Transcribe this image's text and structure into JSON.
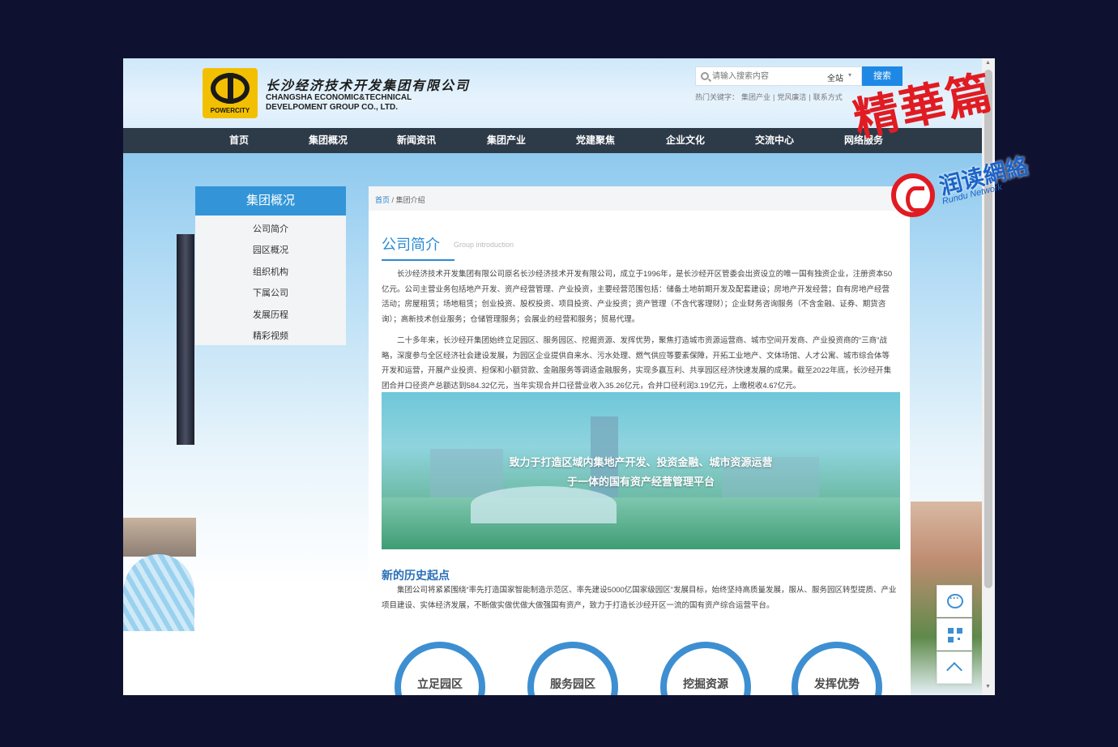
{
  "header": {
    "logo_cn": "长沙经济技术开发集团有限公司",
    "logo_en_line1": "CHANGSHA ECONOMIC&TECHNICAL",
    "logo_en_line2": "DEVELPOMENT GROUP CO., LTD.",
    "emblem_label": "POWERCITY",
    "search": {
      "placeholder": "请输入搜索内容",
      "scope": "全站",
      "button": "搜索"
    },
    "hotwords": {
      "label": "热门关键字：",
      "items": [
        "集团产业",
        "党风廉洁",
        "联系方式"
      ]
    }
  },
  "nav": [
    "首页",
    "集团概况",
    "新闻资讯",
    "集团产业",
    "党建聚焦",
    "企业文化",
    "交流中心",
    "网络服务"
  ],
  "sidebar": {
    "title": "集团概况",
    "items": [
      "公司简介",
      "园区概况",
      "组织机构",
      "下属公司",
      "发展历程",
      "精彩视频"
    ]
  },
  "breadcrumb": {
    "home": "首页",
    "sep": "/",
    "current": "集团介绍"
  },
  "section": {
    "title": "公司简介",
    "subtitle": "Group introduction",
    "para1": "长沙经济技术开发集团有限公司原名长沙经济技术开发有限公司，成立于1996年，是长沙经开区管委会出资设立的唯一国有独资企业，注册资本50亿元。公司主营业务包括地产开发、资产经营管理、产业投资，主要经营范围包括：储备土地前期开发及配套建设；房地产开发经营；自有房地产经营活动；房屋租赁；场地租赁；创业投资、股权投资、项目投资、产业投资；资产管理（不含代客理财）；企业财务咨询服务（不含金融、证券、期货咨询）；高新技术创业服务；仓储管理服务；会展业的经营和服务；贸易代理。",
    "para2": "二十多年来，长沙经开集团始终立足园区、服务园区、挖掘资源、发挥优势，聚焦打造城市资源运营商、城市空间开发商、产业投资商的“三商”战略，深度参与全区经济社会建设发展，为园区企业提供自来水、污水处理、燃气供应等要素保障，开拓工业地产、文体场馆、人才公寓、城市综合体等开发和运营，开展产业投资、担保和小额贷款、金融服务等调适金融服务，实现多赢互利、共享园区经济快速发展的成果。截至2022年底，长沙经开集团合并口径资产总额达到584.32亿元，当年实现合并口径营业收入35.26亿元，合并口径利润3.19亿元，上缴税收4.67亿元。"
  },
  "banner": {
    "line1": "致力于打造区域内集地产开发、投资金融、城市资源运营",
    "line2": "于一体的国有资产经营管理平台"
  },
  "history": {
    "title": "新的历史起点",
    "text": "集团公司将紧紧围绕“率先打造国家智能制造示范区、率先建设5000亿国家级园区”发展目标，始终坚持高质量发展，服从、服务园区转型提质、产业项目建设、实体经济发展，不断做实做优做大做强国有资产，致力于打造长沙经开区一流的国有资产综合运营平台。"
  },
  "circles": [
    "立足园区",
    "服务园区",
    "挖掘资源",
    "发挥优势"
  ],
  "watermark": {
    "text": "精華篇",
    "brand": "润读網絡",
    "sub": "Rundu Network"
  },
  "colors": {
    "accent": "#3395d8",
    "nav_bg": "#2d3a48",
    "title_blue": "#2a8bd5",
    "watermark_red": "#e11b22"
  }
}
